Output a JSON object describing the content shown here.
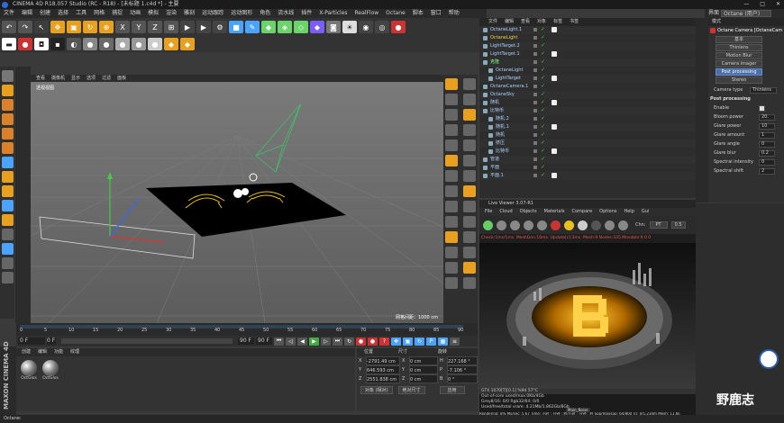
{
  "window": {
    "title": "CINEMA 4D R18.057 Studio (RC - R18) - [未标题 1.c4d *] - 主要",
    "controls": [
      "—",
      "□",
      "✕"
    ]
  },
  "menu": [
    "文件",
    "编辑",
    "创建",
    "选择",
    "工具",
    "网格",
    "捕捉",
    "动画",
    "模拟",
    "渲染",
    "雕刻",
    "运动跟踪",
    "运动图形",
    "角色",
    "流水线",
    "插件",
    "X-Particles",
    "RealFlow",
    "Octane",
    "脚本",
    "窗口",
    "帮助"
  ],
  "layout": {
    "label": "界面",
    "value": "Octane (用户)"
  },
  "viewport": {
    "menu": [
      "查看",
      "摄像机",
      "显示",
      "选项",
      "过滤",
      "面板"
    ],
    "name": "透视视图",
    "grid": "网格间距：1000 cm"
  },
  "timeline": {
    "ticks": [
      "0",
      "5",
      "10",
      "15",
      "20",
      "25",
      "30",
      "35",
      "40",
      "45",
      "50",
      "55",
      "60",
      "65",
      "70",
      "75",
      "80",
      "85",
      "90"
    ],
    "end_label": "0 F"
  },
  "transport": {
    "start": "0 F",
    "cur": "0 F",
    "end": "90 F",
    "end2": "90 F"
  },
  "materials": {
    "tabs": [
      "创建",
      "编辑",
      "功能",
      "纹理"
    ],
    "items": [
      "OctGlos",
      "OctGlos"
    ]
  },
  "coords": {
    "headers": [
      "位置",
      "尺寸",
      "旋转"
    ],
    "rows": [
      {
        "axis": "X",
        "pos": "-2791.49 cm",
        "size": "0 cm",
        "rotlabel": "H",
        "rot": "227.168 °"
      },
      {
        "axis": "Y",
        "pos": "646.593 cm",
        "size": "0 cm",
        "rotlabel": "P",
        "rot": "-7.106 °"
      },
      {
        "axis": "Z",
        "pos": "2551.838 cm",
        "size": "0 cm",
        "rotlabel": "B",
        "rot": "0 °"
      }
    ],
    "mode": "对象 (相对)",
    "size_mode": "绝对尺寸",
    "apply": "应用"
  },
  "objects": {
    "tabs": [
      "文件",
      "编辑",
      "查看",
      "对象",
      "标签",
      "书签"
    ],
    "items": [
      {
        "name": "OctaneLight.1",
        "indent": 0,
        "color": "#aed3ff"
      },
      {
        "name": "OctaneLight",
        "indent": 0,
        "color": "#ffd24a"
      },
      {
        "name": "LightTarget.2",
        "indent": 0,
        "color": "#aed3ff"
      },
      {
        "name": "LightTarget.1",
        "indent": 0,
        "color": "#aed3ff"
      },
      {
        "name": "克隆",
        "indent": 0,
        "color": "#7dff7d"
      },
      {
        "name": "OctaneLight",
        "indent": 1,
        "color": "#aed3ff"
      },
      {
        "name": "LightTarget",
        "indent": 1,
        "color": "#aed3ff"
      },
      {
        "name": "OctaneCamera.1",
        "indent": 0,
        "color": "#aed3ff"
      },
      {
        "name": "OctaneSky",
        "indent": 0,
        "color": "#aed3ff"
      },
      {
        "name": "随机",
        "indent": 0,
        "color": "#aed3ff"
      },
      {
        "name": "比特币",
        "indent": 0,
        "color": "#aed3ff"
      },
      {
        "name": "随机.2",
        "indent": 1,
        "color": "#aed3ff"
      },
      {
        "name": "随机.1",
        "indent": 1,
        "color": "#aed3ff"
      },
      {
        "name": "随机",
        "indent": 1,
        "color": "#aed3ff"
      },
      {
        "name": "挤压",
        "indent": 1,
        "color": "#aed3ff"
      },
      {
        "name": "比特币",
        "indent": 1,
        "color": "#aed3ff"
      },
      {
        "name": "管道",
        "indent": 0,
        "color": "#aed3ff"
      },
      {
        "name": "平面",
        "indent": 0,
        "color": "#aed3ff"
      },
      {
        "name": "平面.1",
        "indent": 0,
        "color": "#aed3ff"
      }
    ]
  },
  "attributes": {
    "header": "模式",
    "title": "Octane Camera [OctaneCam",
    "buttons": [
      "基本",
      "Thinlens",
      "Motion Blur",
      "Camera imager",
      "Post processing",
      "Stereo"
    ],
    "camera_type_label": "Camera type",
    "camera_type": "Thinlens",
    "section": "Post processing",
    "fields": [
      {
        "label": "Enable",
        "value": ""
      },
      {
        "label": "Bloom power",
        "value": "20."
      },
      {
        "label": "Glare power",
        "value": "10"
      },
      {
        "label": "Glare amount",
        "value": "1"
      },
      {
        "label": "Glare angle",
        "value": "0"
      },
      {
        "label": "Glare blur",
        "value": "0.2"
      },
      {
        "label": "Spectral intensity",
        "value": "0"
      },
      {
        "label": "Spectral shift",
        "value": "2"
      }
    ]
  },
  "liveviewer": {
    "title": "Live Viewer 3.07-R1",
    "menu": [
      "File",
      "Cloud",
      "Objects",
      "Materials",
      "Compare",
      "Options",
      "Help",
      "Gui"
    ],
    "chn_label": "Chn:",
    "chn": "PT",
    "zoom": "0.5",
    "status_line": "Check:1ms/1ms. MeshGen:16ms. Update[c]:3ms. Mesh:9 Nodes:335 Movable:9  0 0",
    "gpu": "GTX 1070[T][0.1]      %94     57°C",
    "info": [
      "Out-of-core used/max:0Kb/4Gb",
      "Grey8/16: 0/0        Rgb32/64: 0/0",
      "Used/free/total vram: 4.21Mb/1.862Gb/8Gb",
      "Rendering: 8%   Ms/sec: 5.67   Time: 小时 : 分钟 : 秒/小时 : 分钟 : 秒   Spp/maxspp: 64/800   Tri: 0/1.234m   Mesh: 11.6k"
    ],
    "material_tag": "Main_Noise"
  },
  "status": "Octane:",
  "watermark": "野鹿志"
}
